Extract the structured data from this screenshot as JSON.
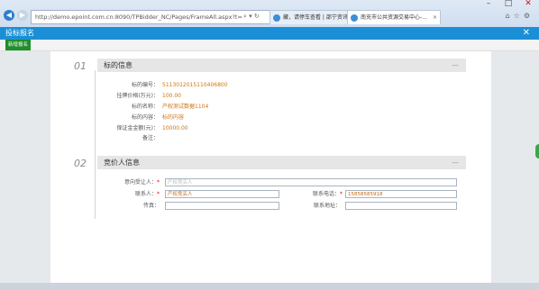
{
  "browser": {
    "address_url": "http://demo.epoint.com.cn:8090/TPBidder_NC/Pages/FrameAll.aspx?t=",
    "address_host_bold": "epoint.com.cn",
    "tabs": [
      {
        "label": "藏，请停车查看 | 邵宁资讯馆"
      },
      {
        "label": "南充市公共资源交易中心-..."
      }
    ]
  },
  "window": {
    "title": "投标报名"
  },
  "toolbar": {
    "new_button": "新增报名"
  },
  "sections": [
    {
      "number": "01",
      "title": "标的信息",
      "collapse": "—",
      "fields": [
        {
          "label": "标的编号：",
          "value": "5113012015110406800"
        },
        {
          "label": "挂牌价格(万元)：",
          "value": "100.00"
        },
        {
          "label": "标的名称：",
          "value": "产权测试数据1104"
        },
        {
          "label": "标的内容：",
          "value": "标的内容"
        },
        {
          "label": "保证金金额(元)：",
          "value": "10000.00"
        },
        {
          "label": "备注：",
          "value": ""
        }
      ]
    },
    {
      "number": "02",
      "title": "竞价人信息",
      "collapse": "—",
      "form": {
        "intended_transferee": {
          "label": "意向受让人：",
          "placeholder": "产权竞买人"
        },
        "contact_person": {
          "label": "联系人：",
          "value": "产权竞买人"
        },
        "contact_phone": {
          "label": "联系电话：",
          "value": "15858585918"
        },
        "fax": {
          "label": "传真：",
          "value": ""
        },
        "contact_address": {
          "label": "联系地址：",
          "value": ""
        },
        "required_mark": "*"
      }
    }
  ]
}
